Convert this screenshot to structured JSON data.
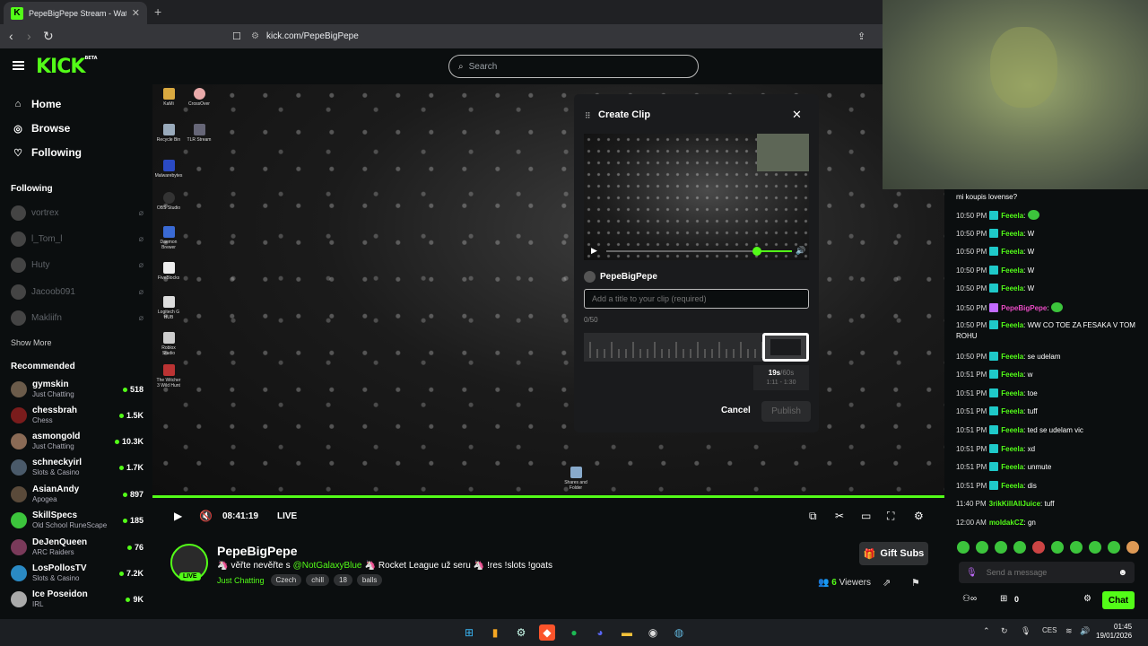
{
  "browser": {
    "tab_title": "PepeBigPepe Stream - Watch Liv",
    "url": "kick.com/PepeBigPepe"
  },
  "header": {
    "logo": "KICK",
    "logo_badge": "BETA",
    "search_placeholder": "Search"
  },
  "sidebar": {
    "nav": [
      {
        "label": "Home",
        "icon": "home-icon"
      },
      {
        "label": "Browse",
        "icon": "compass-icon"
      },
      {
        "label": "Following",
        "icon": "heart-icon"
      }
    ],
    "following_title": "Following",
    "following": [
      "vortrex",
      "l_Tom_l",
      "Huty",
      "Jacoob091",
      "Makliifn"
    ],
    "show_more": "Show More",
    "recommended_title": "Recommended",
    "recommended": [
      {
        "name": "gymskin",
        "category": "Just Chatting",
        "viewers": "518",
        "color": "#6b5b4a"
      },
      {
        "name": "chessbrah",
        "category": "Chess",
        "viewers": "1.5K",
        "color": "#7a1c1c"
      },
      {
        "name": "asmongold",
        "category": "Just Chatting",
        "viewers": "10.3K",
        "color": "#8a6a55"
      },
      {
        "name": "schneckyirl",
        "category": "Slots & Casino",
        "viewers": "1.7K",
        "color": "#4a5a6a"
      },
      {
        "name": "AsianAndy",
        "category": "Apogea",
        "viewers": "897",
        "color": "#5a4a3a"
      },
      {
        "name": "SkillSpecs",
        "category": "Old School RuneScape",
        "viewers": "185",
        "color": "#3cc43c"
      },
      {
        "name": "DeJenQueen",
        "category": "ARC Raiders",
        "viewers": "76",
        "color": "#7a3a5a"
      },
      {
        "name": "LosPollosTV",
        "category": "Slots & Casino",
        "viewers": "7.2K",
        "color": "#2a8ac4"
      },
      {
        "name": "Ice Poseidon",
        "category": "IRL",
        "viewers": "9K",
        "color": "#aaaaaa"
      }
    ]
  },
  "desktop_icons": [
    "KaMi",
    "CrossOver",
    "Recycle Bin",
    "TLR Stream",
    "Malwarebytes",
    "OBS Studio",
    "Daemon Brewer",
    "FiveBlocks",
    "Logitech G HUB",
    "Roblox Studio",
    "The Witcher 3 Wild Hunt",
    "Shares and Folder"
  ],
  "player": {
    "time": "08:41:19",
    "live_label": "LIVE"
  },
  "stream": {
    "name": "PepeBigPepe",
    "live_badge": "LIVE",
    "title_pre": "věřte nevěřte s",
    "title_mention": "@NotGalaxyBlue",
    "title_post": "Rocket League už seru",
    "title_cmds": "!res !slots !goats",
    "category": "Just Chatting",
    "tags": [
      "Czech",
      "chill",
      "18",
      "balls"
    ],
    "gift_label": "Gift Subs",
    "viewers_count": "6",
    "viewers_label": "Viewers"
  },
  "clip_modal": {
    "title": "Create Clip",
    "channel": "PepeBigPepe",
    "input_placeholder": "Add a title to your clip (required)",
    "char_count": "0/50",
    "duration": "19s",
    "duration_max": "/60s",
    "range": "1:11 - 1:30",
    "cancel": "Cancel",
    "publish": "Publish",
    "volume_fraction": 0.82
  },
  "chat": {
    "messages": [
      {
        "time": "",
        "user": "",
        "text": "mi koupis lovense?",
        "badge": false
      },
      {
        "time": "10:50 PM",
        "user": "Feeela",
        "text": "",
        "emote": true,
        "badge": true
      },
      {
        "time": "10:50 PM",
        "user": "Feeela",
        "text": "W",
        "badge": true
      },
      {
        "time": "10:50 PM",
        "user": "Feeela",
        "text": "W",
        "badge": true
      },
      {
        "time": "10:50 PM",
        "user": "Feeela",
        "text": "W",
        "badge": true
      },
      {
        "time": "10:50 PM",
        "user": "Feeela",
        "text": "W",
        "badge": true
      },
      {
        "time": "10:50 PM",
        "user": "PepeBigPepe",
        "text": "",
        "emote": true,
        "badge": true,
        "color": "#e94bc4"
      },
      {
        "time": "10:50 PM",
        "user": "Feeela",
        "text": "WW CO TOE ZA FESAKA V TOM ROHU",
        "badge": true
      },
      {
        "time": "10:50 PM",
        "user": "Feeela",
        "text": "se udelam",
        "badge": true
      },
      {
        "time": "10:51 PM",
        "user": "Feeela",
        "text": "w",
        "badge": true
      },
      {
        "time": "10:51 PM",
        "user": "Feeela",
        "text": "toe",
        "badge": true
      },
      {
        "time": "10:51 PM",
        "user": "Feeela",
        "text": "tuff",
        "badge": true
      },
      {
        "time": "10:51 PM",
        "user": "Feeela",
        "text": "ted se udelam vic",
        "badge": true
      },
      {
        "time": "10:51 PM",
        "user": "Feeela",
        "text": "xd",
        "badge": true
      },
      {
        "time": "10:51 PM",
        "user": "Feeela",
        "text": "unmute",
        "badge": true
      },
      {
        "time": "10:51 PM",
        "user": "Feeela",
        "text": "dis",
        "badge": true
      },
      {
        "time": "11:40 PM",
        "user": "3rikKillAllJuice",
        "text": "tuff",
        "badge": false
      },
      {
        "time": "12:00 AM",
        "user": "moldakCZ",
        "text": "gn",
        "badge": false
      }
    ],
    "send_placeholder": "Send a message",
    "points": "0",
    "chat_button": "Chat"
  },
  "taskbar": {
    "lang": "CES",
    "time": "01:45",
    "date": "19/01/2026"
  }
}
